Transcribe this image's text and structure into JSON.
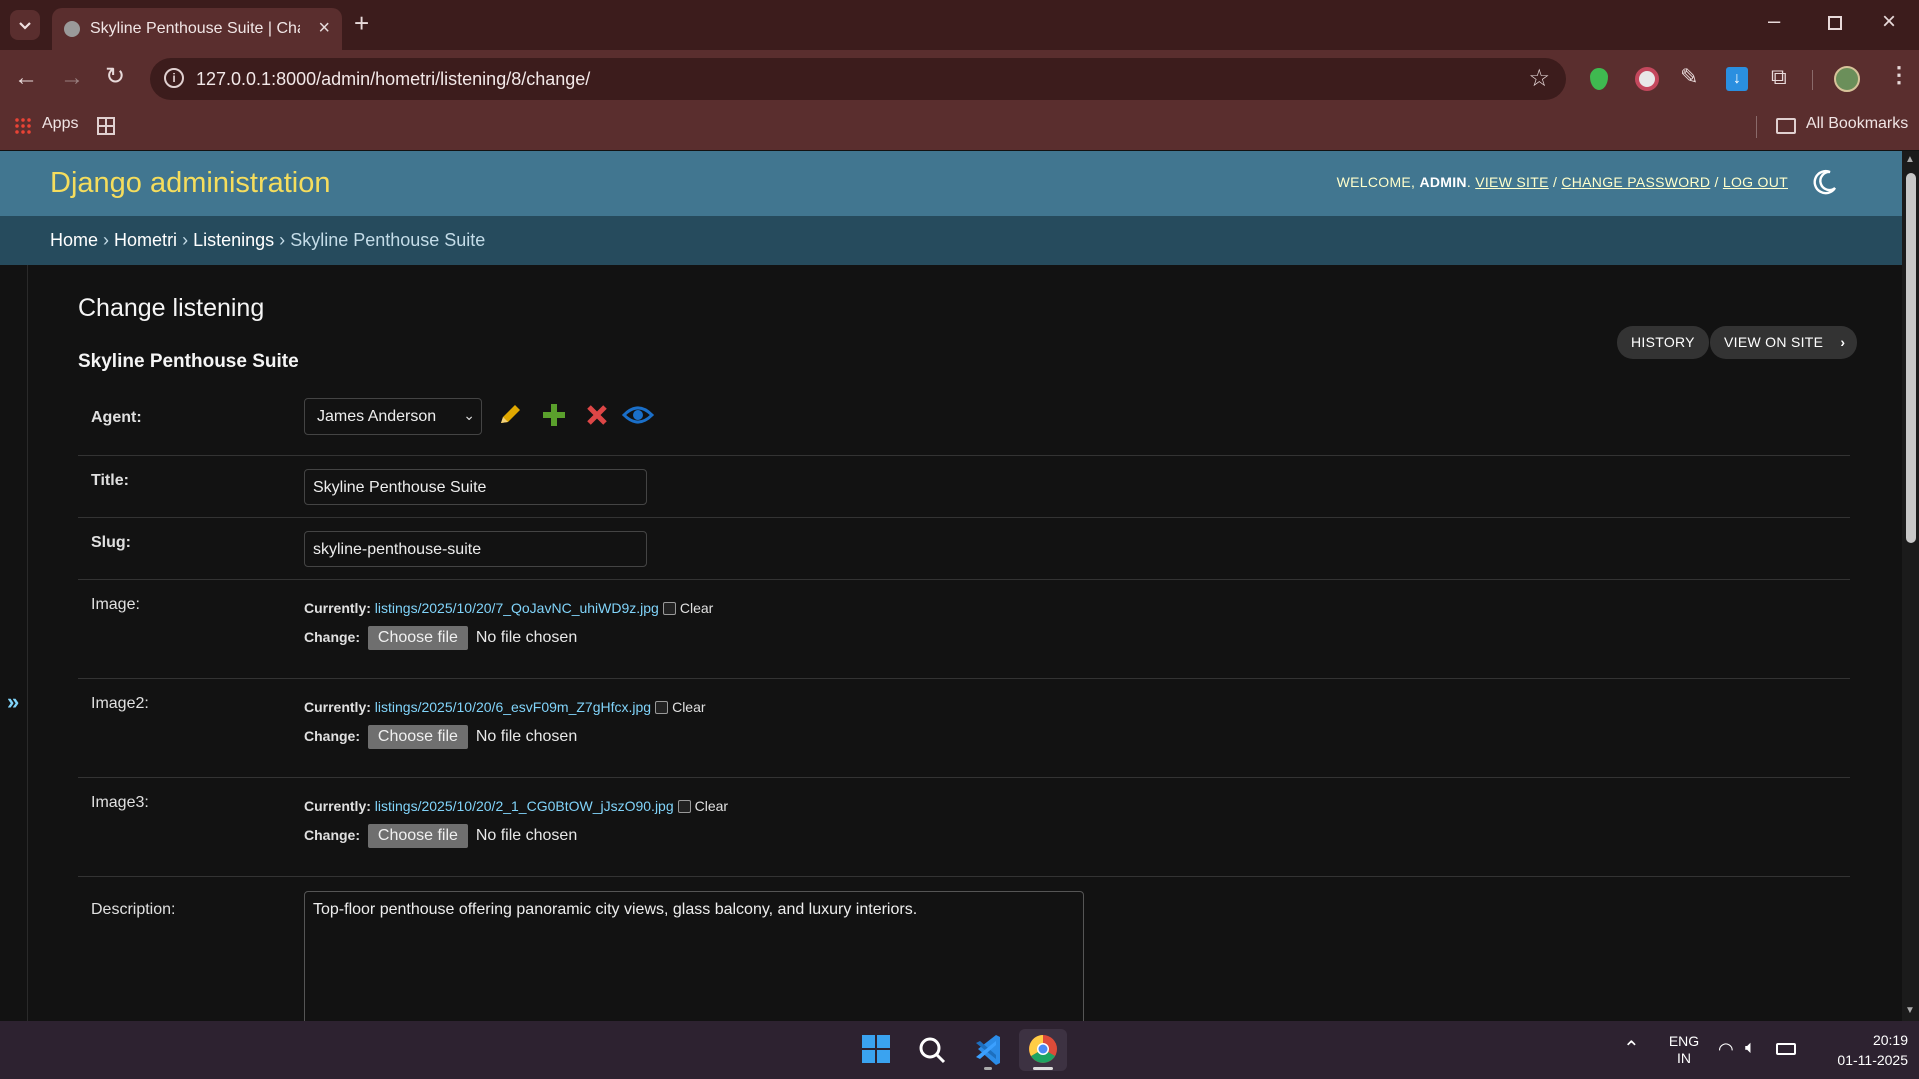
{
  "browser": {
    "tab_title": "Skyline Penthouse Suite | Change",
    "url": "127.0.0.1:8000/admin/hometri/listening/8/change/",
    "bookmarks": {
      "apps_label": "Apps",
      "all_bookmarks_label": "All Bookmarks"
    }
  },
  "header": {
    "branding": "Django administration",
    "welcome_prefix": "WELCOME,",
    "username": "ADMIN",
    "view_site": "VIEW SITE",
    "change_password": "CHANGE PASSWORD",
    "log_out": "LOG OUT",
    "separator": "/"
  },
  "breadcrumbs": {
    "home": "Home",
    "app": "Hometri",
    "model": "Listenings",
    "object": "Skyline Penthouse Suite",
    "sep": "›"
  },
  "page": {
    "title": "Change listening",
    "object_title": "Skyline Penthouse Suite",
    "history_button": "HISTORY",
    "view_on_site_button": "VIEW ON SITE"
  },
  "form": {
    "agent": {
      "label": "Agent:",
      "value": "James Anderson"
    },
    "title": {
      "label": "Title:",
      "value": "Skyline Penthouse Suite"
    },
    "slug": {
      "label": "Slug:",
      "value": "skyline-penthouse-suite"
    },
    "image": {
      "label": "Image:",
      "currently": "Currently:",
      "file": "listings/2025/10/20/7_QoJavNC_uhiWD9z.jpg",
      "clear": "Clear",
      "change": "Change:",
      "choose": "Choose file",
      "nofile": "No file chosen"
    },
    "image2": {
      "label": "Image2:",
      "currently": "Currently:",
      "file": "listings/2025/10/20/6_esvF09m_Z7gHfcx.jpg",
      "clear": "Clear",
      "change": "Change:",
      "choose": "Choose file",
      "nofile": "No file chosen"
    },
    "image3": {
      "label": "Image3:",
      "currently": "Currently:",
      "file": "listings/2025/10/20/2_1_CG0BtOW_jJszO90.jpg",
      "clear": "Clear",
      "change": "Change:",
      "choose": "Choose file",
      "nofile": "No file chosen"
    },
    "description": {
      "label": "Description:",
      "value": "Top-floor penthouse offering panoramic city views, glass balcony, and luxury interiors."
    }
  },
  "sidebar_toggle": "»",
  "taskbar": {
    "lang_top": "ENG",
    "lang_bottom": "IN",
    "time": "20:19",
    "date": "01-11-2025"
  },
  "colors": {
    "header_bg": "#417690",
    "breadcrumbs_bg": "#264b5d",
    "branding": "#f5dd5d",
    "link": "#81d4fa",
    "chrome_frame": "#5a2e2e"
  }
}
